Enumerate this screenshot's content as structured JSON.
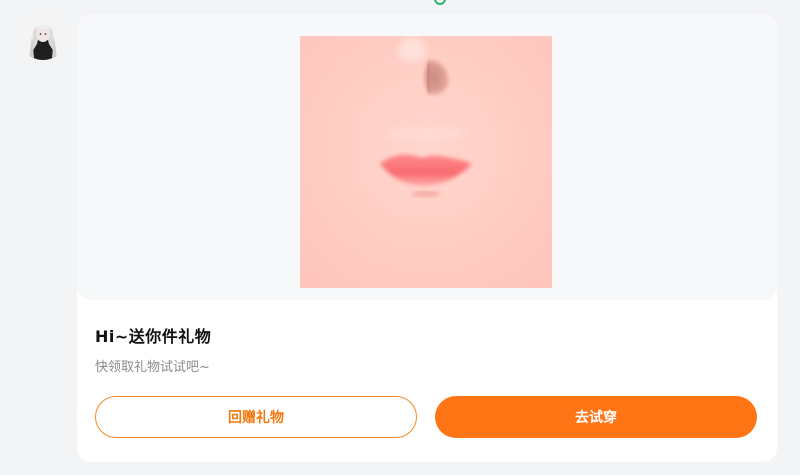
{
  "message": {
    "gift_title": "Hi~送你件礼物",
    "gift_subtitle": "快领取礼物试试吧~",
    "buttons": {
      "return_gift": "回赠礼物",
      "try_on": "去试穿"
    }
  },
  "colors": {
    "accent": "#ff7414",
    "accent_border": "#f08a26",
    "status_dot": "#22b46a",
    "card_bg": "#ffffff",
    "page_bg": "#f3f4f6",
    "media_bg": "#f7f8fa",
    "skin": "#ffcfc6"
  },
  "icons": {
    "status": "status-dot-icon",
    "avatar": "user-avatar"
  }
}
